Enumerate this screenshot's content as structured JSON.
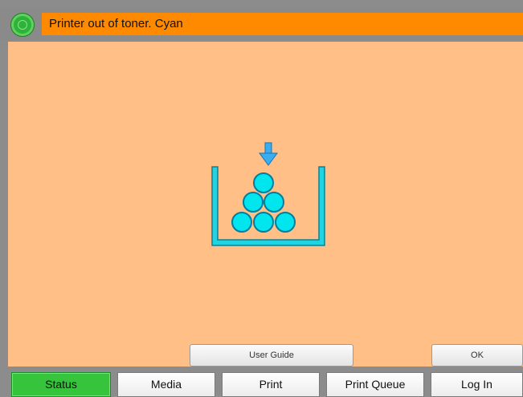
{
  "header": {
    "message": "Printer out of toner. Cyan",
    "status_light_color": "#2db33a",
    "message_bar_color": "#ff8a00"
  },
  "content": {
    "background_color": "#ffbf86",
    "illustration": {
      "icon": "toner-refill-icon",
      "toner_color": "#00e5ee"
    }
  },
  "actions": {
    "user_guide_label": "User Guide",
    "ok_label": "OK"
  },
  "tabs": [
    {
      "label": "Status",
      "active": true
    },
    {
      "label": "Media",
      "active": false
    },
    {
      "label": "Print",
      "active": false
    },
    {
      "label": "Print Queue",
      "active": false
    },
    {
      "label": "Log In",
      "active": false
    }
  ]
}
